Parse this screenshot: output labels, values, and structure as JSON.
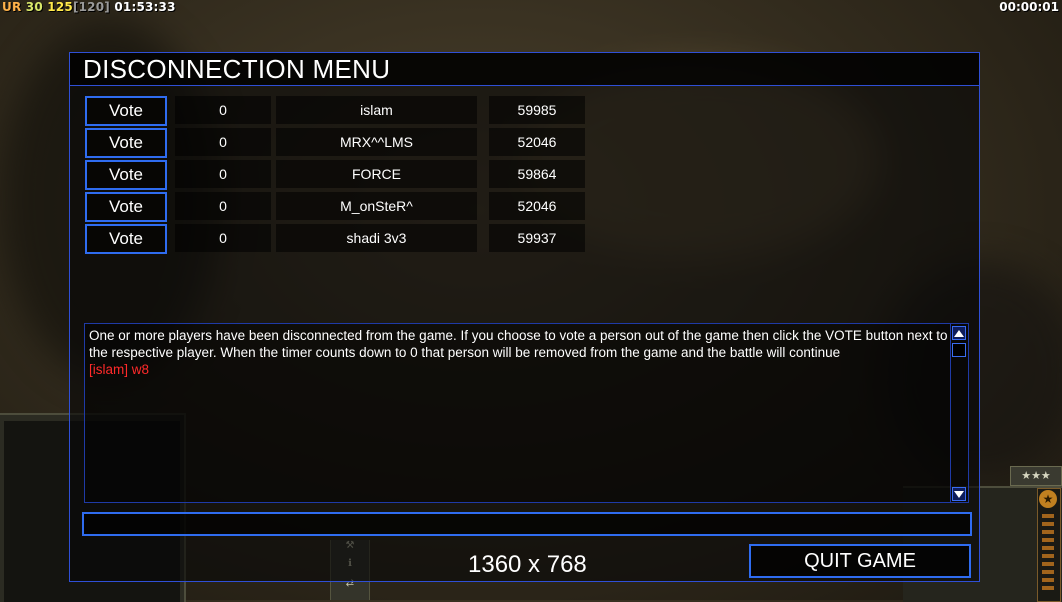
{
  "hud": {
    "ur_label": "UR",
    "value_a": "30",
    "value_b": "125",
    "value_c": "[120]",
    "clock": "01:53:33",
    "timer": "00:00:01"
  },
  "dialog": {
    "title": "DISCONNECTION MENU",
    "vote_label": "Vote",
    "players": [
      {
        "count": "0",
        "name": "islam",
        "ping": "59985"
      },
      {
        "count": "0",
        "name": "MRX^^LMS",
        "ping": "52046"
      },
      {
        "count": "0",
        "name": "FORCE",
        "ping": "59864"
      },
      {
        "count": "0",
        "name": "M_onSteR^",
        "ping": "52046"
      },
      {
        "count": "0",
        "name": "shadi 3v3",
        "ping": "59937"
      }
    ],
    "message": "One or more players have been disconnected from the game. If you choose to vote a person out of the game then click the VOTE button next to the respective player. When the timer counts down to 0 that person will be removed from the game and the battle will continue",
    "chat_line": "[islam] w8",
    "chat_input_value": "",
    "resolution": "1360 x 768",
    "quit_label": "QUIT GAME"
  },
  "colors": {
    "border_blue": "#2f6cf0",
    "chat_red": "#ff2a2a"
  },
  "icons": [
    "scroll-up-icon",
    "scroll-down-icon",
    "wrench-icon",
    "info-icon",
    "arrows-icon",
    "rank-stars-icon",
    "general-star-icon"
  ]
}
